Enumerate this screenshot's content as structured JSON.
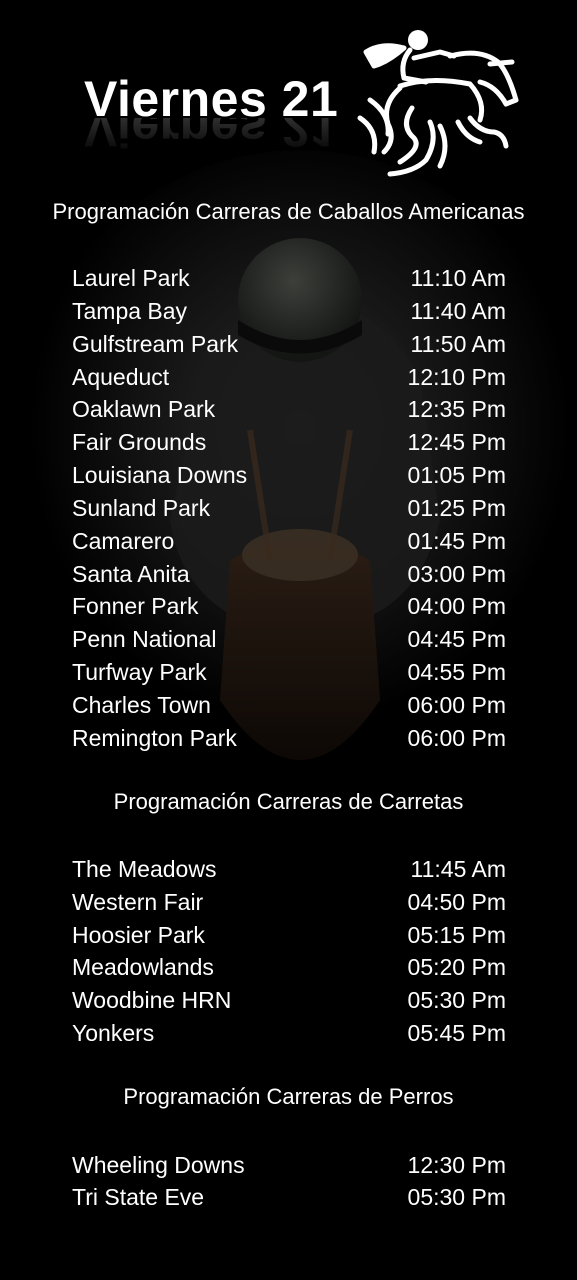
{
  "header": {
    "title": "Viernes 21"
  },
  "sections": [
    {
      "title": "Programación Carreras de Caballos Americanas",
      "rows": [
        {
          "track": "Laurel Park",
          "time": "11:10 Am"
        },
        {
          "track": "Tampa Bay",
          "time": "11:40 Am"
        },
        {
          "track": "Gulfstream Park",
          "time": "11:50 Am"
        },
        {
          "track": "Aqueduct",
          "time": "12:10 Pm"
        },
        {
          "track": "Oaklawn Park",
          "time": "12:35 Pm"
        },
        {
          "track": "Fair Grounds",
          "time": "12:45 Pm"
        },
        {
          "track": "Louisiana Downs",
          "time": "01:05 Pm"
        },
        {
          "track": "Sunland Park",
          "time": "01:25 Pm"
        },
        {
          "track": "Camarero",
          "time": "01:45 Pm"
        },
        {
          "track": "Santa Anita",
          "time": "03:00 Pm"
        },
        {
          "track": "Fonner Park",
          "time": "04:00 Pm"
        },
        {
          "track": "Penn National",
          "time": "04:45 Pm"
        },
        {
          "track": "Turfway Park",
          "time": "04:55 Pm"
        },
        {
          "track": "Charles Town",
          "time": "06:00 Pm"
        },
        {
          "track": "Remington Park",
          "time": "06:00 Pm"
        }
      ]
    },
    {
      "title": "Programación Carreras de Carretas",
      "rows": [
        {
          "track": "The Meadows",
          "time": "11:45 Am"
        },
        {
          "track": "Western Fair",
          "time": "04:50 Pm"
        },
        {
          "track": "Hoosier Park",
          "time": "05:15 Pm"
        },
        {
          "track": "Meadowlands",
          "time": "05:20 Pm"
        },
        {
          "track": "Woodbine HRN",
          "time": "05:30 Pm"
        },
        {
          "track": "Yonkers",
          "time": "05:45 Pm"
        }
      ]
    },
    {
      "title": "Programación Carreras de Perros",
      "rows": [
        {
          "track": "Wheeling Downs",
          "time": "12:30 Pm"
        },
        {
          "track": "Tri State Eve",
          "time": "05:30 Pm"
        }
      ]
    }
  ],
  "colors": {
    "background": "#000000",
    "text": "#ffffff"
  },
  "icons": {
    "logo": "horse-jockey-logo-icon",
    "background_art": "jockey-riding-horse-photo"
  }
}
